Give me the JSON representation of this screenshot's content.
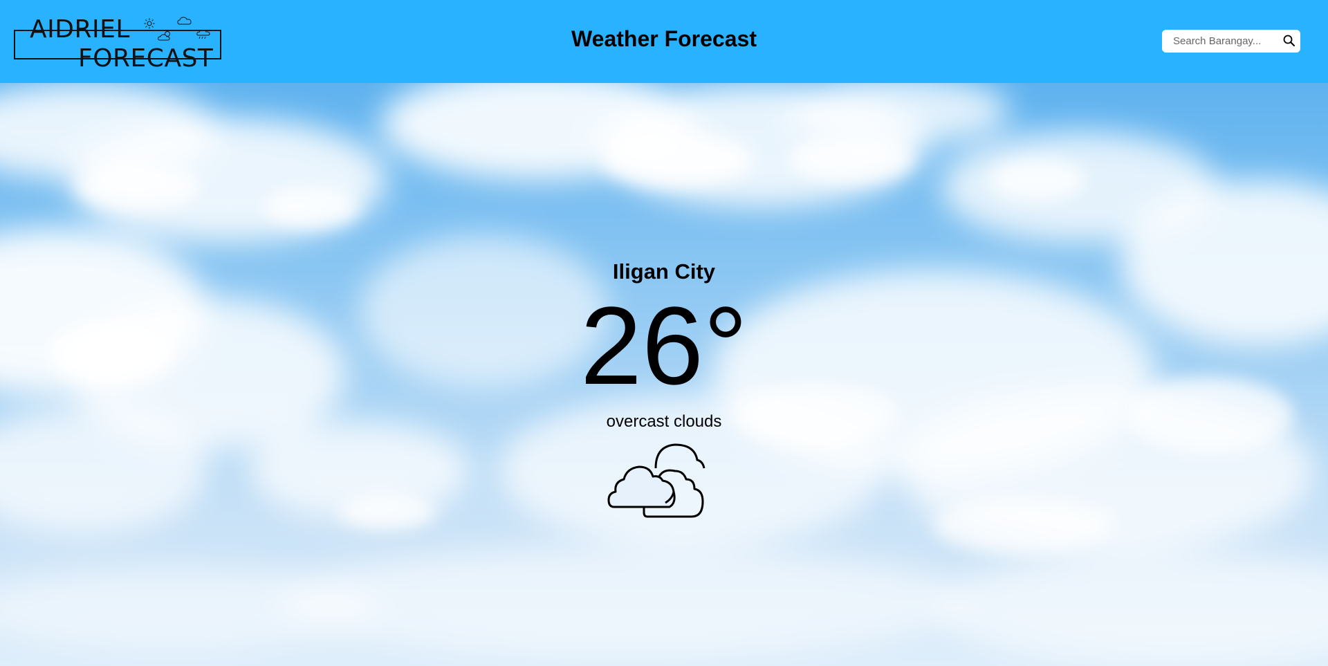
{
  "header": {
    "logo_line1": "AIDRIEL",
    "logo_line2": "FORECAST",
    "title": "Weather Forecast",
    "background_color": "#29b2ff"
  },
  "search": {
    "placeholder": "Search Barangay...",
    "value": "",
    "button_icon": "search-icon"
  },
  "weather": {
    "city": "Iligan City",
    "temperature": "26°",
    "description": "overcast clouds",
    "condition_icon": "overcast-clouds-icon"
  },
  "logo_icons": [
    "sun-icon",
    "cloud-icon",
    "partly-cloudy-icon",
    "rain-cloud-icon"
  ]
}
